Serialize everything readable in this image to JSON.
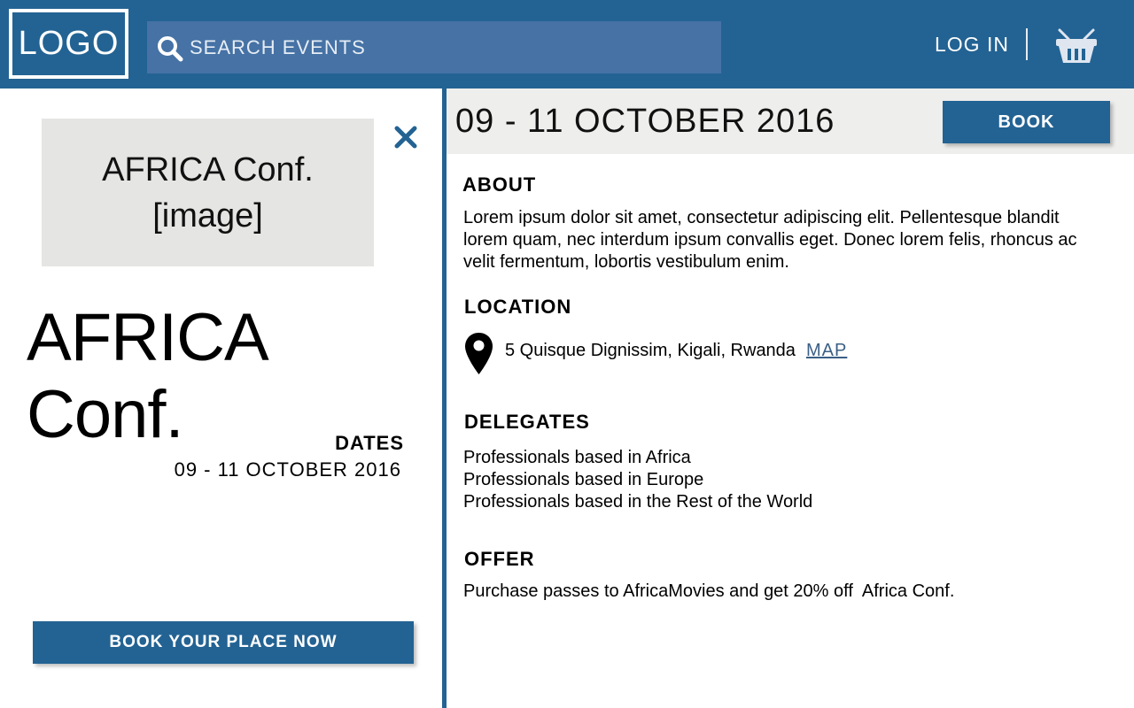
{
  "header": {
    "logo": "LOGO",
    "search_placeholder": "SEARCH EVENTS",
    "login_label": "LOG IN",
    "basket_icon": "basket-icon"
  },
  "colors": {
    "primary": "#236393",
    "search_bg": "#4672a5",
    "placeholder_bg": "#e5e5e3",
    "date_bar_bg": "#eeeeec",
    "link": "#3b5f86"
  },
  "left_panel": {
    "image_line1": "AFRICA Conf.",
    "image_line2": "[image]",
    "title": "AFRICA Conf.",
    "dates_label": "DATES",
    "dates_value": "09 - 11 OCTOBER 2016",
    "book_now_label": "BOOK YOUR PLACE NOW"
  },
  "right_panel": {
    "date_bar": "09 - 11 OCTOBER 2016",
    "book_label": "BOOK",
    "about": {
      "title": "ABOUT",
      "text": "Lorem ipsum dolor sit amet, consectetur adipiscing elit. Pellentesque blandit lorem quam, nec interdum ipsum convallis eget. Donec lorem felis, rhoncus ac velit fermentum, lobortis vestibulum enim."
    },
    "location": {
      "title": "LOCATION",
      "address": "5 Quisque Dignissim, Kigali, Rwanda",
      "map_label": "MAP"
    },
    "delegates": {
      "title": "DELEGATES",
      "items": [
        "Professionals based in Africa",
        "Professionals based in Europe",
        "Professionals based in the Rest of the World"
      ]
    },
    "offer": {
      "title": "OFFER",
      "text": "Purchase passes to AfricaMovies and get 20% off  Africa Conf."
    }
  }
}
